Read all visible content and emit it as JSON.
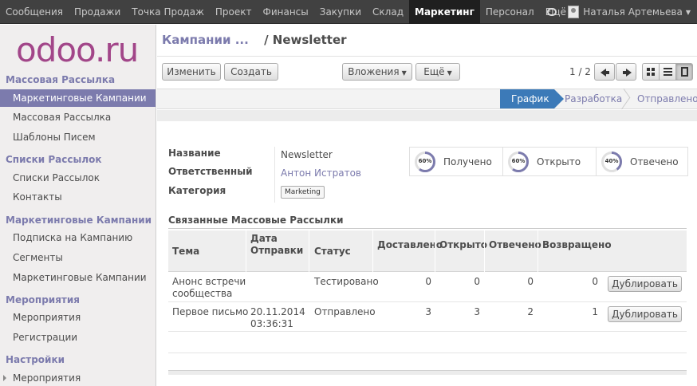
{
  "topnav": {
    "items": [
      "Сообщения",
      "Продажи",
      "Точка Продаж",
      "Проект",
      "Финансы",
      "Закупки",
      "Склад",
      "Маркетинг",
      "Персонал",
      "Ещё"
    ],
    "active": "Маркетинг",
    "user": "Наталья Артемьева"
  },
  "sidebar": {
    "logo": "odoo",
    "logo_suffix": ".ru",
    "groups": [
      {
        "title": "Массовая Рассылка",
        "items": [
          "Маркетинговые Кампании",
          "Массовая Рассылка",
          "Шаблоны Писем"
        ]
      },
      {
        "title": "Списки Рассылок",
        "items": [
          "Списки Рассылок",
          "Контакты"
        ]
      },
      {
        "title": "Маркетинговые Кампании",
        "items": [
          "Подписка на Кампанию",
          "Сегменты",
          "Маркетинговые Кампании"
        ]
      },
      {
        "title": "Мероприятия",
        "items": [
          "Мероприятия",
          "Регистрации"
        ]
      },
      {
        "title": "Настройки",
        "items": [
          "Мероприятия"
        ]
      }
    ]
  },
  "breadcrumb": {
    "parent": "Кампании ...",
    "separator": "/",
    "current": "Newsletter"
  },
  "toolbar": {
    "edit": "Изменить",
    "create": "Создать",
    "attachments": "Вложения",
    "more": "Ещё",
    "pager": "1 / 2"
  },
  "stages": [
    "График",
    "Разработка",
    "Отправлено"
  ],
  "current_stage": "График",
  "form": {
    "name_label": "Название",
    "name_value": "Newsletter",
    "responsible_label": "Ответственный",
    "responsible_value": "Антон Истратов",
    "category_label": "Категория",
    "category_value": "Marketing"
  },
  "stats": [
    {
      "percent": "60%",
      "value": 0.6,
      "label": "Получено"
    },
    {
      "percent": "60%",
      "value": 0.6,
      "label": "Открыто"
    },
    {
      "percent": "40%",
      "value": 0.4,
      "label": "Отвечено"
    }
  ],
  "related": {
    "title": "Связанные Массовые Рассылки",
    "columns": {
      "subject": "Тема",
      "send_date_1": "Дата",
      "send_date_2": "Отправки",
      "status": "Статус",
      "delivered": "Доставлено",
      "opened": "Открыто",
      "replied": "Отвечено",
      "bounced": "Возвращено"
    },
    "rows": [
      {
        "subject_1": "Анонс встречи",
        "subject_2": "сообщества",
        "date_1": "",
        "date_2": "",
        "status": "Тестировано",
        "delivered": "0",
        "opened": "0",
        "replied": "0",
        "bounced": "0",
        "action": "Дублировать"
      },
      {
        "subject_1": "Первое письмо",
        "subject_2": "",
        "date_1": "20.11.2014",
        "date_2": "03:36:31",
        "status": "Отправлено",
        "delivered": "3",
        "opened": "3",
        "replied": "2",
        "bounced": "1",
        "action": "Дублировать"
      }
    ]
  }
}
